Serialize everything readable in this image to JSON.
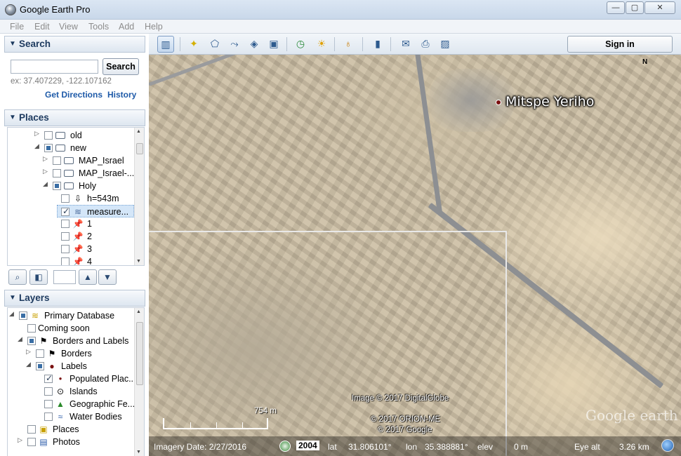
{
  "window": {
    "title": "Google Earth Pro",
    "min": "—",
    "max": "▢",
    "close": "✕"
  },
  "menu": [
    "File",
    "Edit",
    "View",
    "Tools",
    "Add",
    "Help"
  ],
  "search": {
    "header": "Search",
    "input_value": "",
    "button": "Search",
    "hint": "ex: 37.407229, -122.107162",
    "get_directions": "Get Directions",
    "history": "History"
  },
  "places": {
    "header": "Places",
    "items": [
      {
        "label": "old"
      },
      {
        "label": "new"
      },
      {
        "label": "MAP_Israel"
      },
      {
        "label": "MAP_Israel-..."
      },
      {
        "label": "Holy"
      },
      {
        "label": "h=543m"
      },
      {
        "label": "measure..."
      },
      {
        "label": "1"
      },
      {
        "label": "2"
      },
      {
        "label": "3"
      },
      {
        "label": "4"
      }
    ]
  },
  "layers": {
    "header": "Layers",
    "items": [
      {
        "label": "Primary Database"
      },
      {
        "label": "Coming soon"
      },
      {
        "label": "Borders and Labels"
      },
      {
        "label": "Borders"
      },
      {
        "label": "Labels"
      },
      {
        "label": "Populated Plac..."
      },
      {
        "label": "Islands"
      },
      {
        "label": "Geographic Fe..."
      },
      {
        "label": "Water Bodies"
      },
      {
        "label": "Places"
      },
      {
        "label": "Photos"
      }
    ]
  },
  "toolbar": {
    "sign_in": "Sign in"
  },
  "map": {
    "place_label": "Mitspe Yeriho",
    "compass": "N",
    "credit_image": "Image © 2017 DigitalGlobe",
    "credit_orion": "© 2017 ORION-ME",
    "credit_google": "© 2017 Google",
    "watermark": "Google earth",
    "scale_label": "754 m"
  },
  "status": {
    "imagery_date": "Imagery Date: 2/27/2016",
    "year": "2004",
    "lat_label": "lat",
    "lat": "31.806101°",
    "lon_label": "lon",
    "lon": "35.388881°",
    "elev_label": "elev",
    "elev": "0 m",
    "eye_label": "Eye alt",
    "eye": "3.26 km"
  }
}
